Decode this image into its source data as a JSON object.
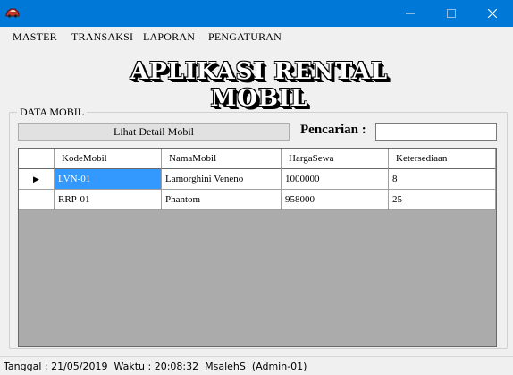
{
  "titlebar": {
    "icon": "car-app-icon",
    "minimize": "—",
    "maximize": "☐",
    "close": "✕"
  },
  "menu": [
    "MASTER",
    "TRANSAKSI",
    "LAPORAN",
    "PENGATURAN"
  ],
  "banner": {
    "title": "APLIKASI RENTAL MOBIL"
  },
  "group": {
    "label": "DATA MOBIL"
  },
  "toolbar": {
    "detail_button": "Lihat Detail Mobil",
    "search_label": "Pencarian :",
    "search_value": ""
  },
  "grid": {
    "columns": [
      "KodeMobil",
      "NamaMobil",
      "HargaSewa",
      "Ketersediaan"
    ],
    "rows": [
      {
        "indicator": "▶",
        "cells": [
          "LVN-01",
          "Lamorghini Veneno",
          "1000000",
          "8"
        ]
      },
      {
        "indicator": "",
        "cells": [
          "RRP-01",
          "Phantom",
          "958000",
          "25"
        ]
      }
    ],
    "selected_row": 0,
    "selected_col": 0
  },
  "status": {
    "text": "Tanggal : 21/05/2019  Waktu : 20:08:32  MsalehS  (Admin-01)"
  },
  "colors": {
    "titlebar": "#0078d7",
    "selection": "#3399ff",
    "grid_background": "#ababab"
  }
}
